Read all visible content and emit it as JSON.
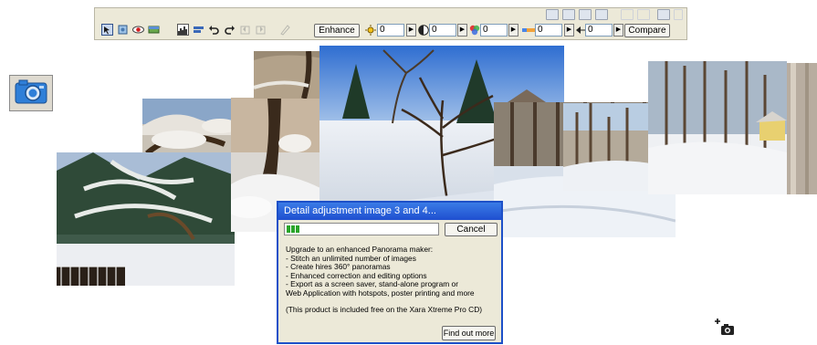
{
  "toolbar": {
    "enhance_label": "Enhance",
    "compare_label": "Compare",
    "brightness_value": "0",
    "contrast_value": "0",
    "saturation_value": "0",
    "temperature_value": "0",
    "sharpness_value": "0",
    "spin_glyph": "▶",
    "icons": [
      "select-tool-icon",
      "crop-tool-icon",
      "red-eye-icon",
      "straighten-icon",
      "histogram-icon",
      "align-icon",
      "undo-icon",
      "redo-icon",
      "rotate-left-icon",
      "rotate-right-icon",
      "brush-icon",
      "brightness-icon",
      "contrast-icon",
      "saturation-icon",
      "temperature-icon",
      "sharpness-icon"
    ]
  },
  "side": {
    "icon": "camera-icon"
  },
  "dialog": {
    "title": "Detail adjustment image 3 and 4...",
    "cancel_label": "Cancel",
    "progress_fraction": 0.04,
    "body_lines": [
      "Upgrade to an enhanced Panorama maker:",
      "- Stitch an unlimited number of images",
      "- Create hires 360° panoramas",
      "- Enhanced correction and editing options",
      "- Export as a screen saver, stand-alone program or",
      "Web Application with hotspots, poster printing and more"
    ],
    "note": "(This product is included free on the Xara Xtreme Pro CD)",
    "find_out_more_label": "Find out more"
  },
  "corner": {
    "icon": "add-photo-icon"
  },
  "colors": {
    "titlebar": "#1f4fd0",
    "toolbar": "#ece9d8",
    "progress": "#2aa52a"
  }
}
